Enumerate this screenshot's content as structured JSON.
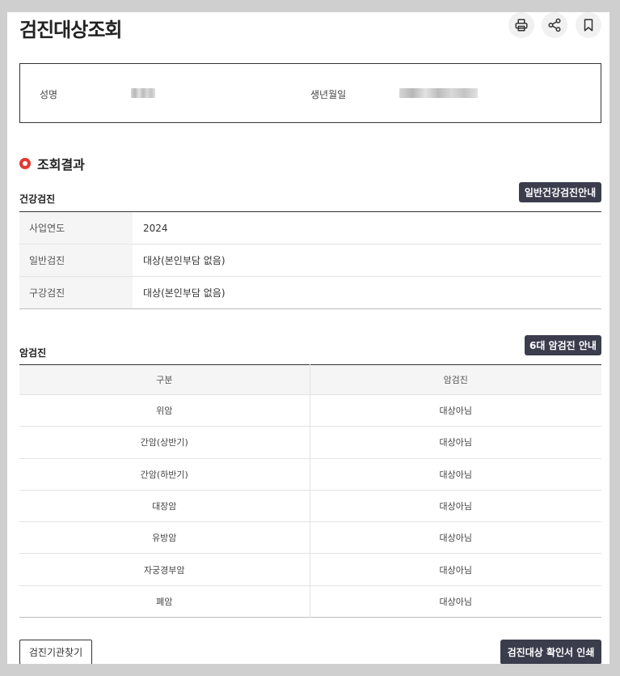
{
  "page": {
    "title": "검진대상조회"
  },
  "toolbar": {
    "print_icon": "print-icon",
    "share_icon": "share-icon",
    "bookmark_icon": "bookmark-icon"
  },
  "person": {
    "name_label": "성명",
    "birth_label": "생년월일"
  },
  "results": {
    "title": "조회결과",
    "health": {
      "title": "건강검진",
      "guide_button": "일반건강검진안내",
      "rows": [
        {
          "label": "사업연도",
          "value": "2024"
        },
        {
          "label": "일반검진",
          "value": "대상(본인부담 없음)"
        },
        {
          "label": "구강검진",
          "value": "대상(본인부담 없음)"
        }
      ]
    },
    "cancer": {
      "title": "암검진",
      "guide_button": "6대 암검진 안내",
      "headers": [
        "구분",
        "암검진"
      ],
      "rows": [
        {
          "type": "위암",
          "status": "대상아님"
        },
        {
          "type": "간암(상반기)",
          "status": "대상아님"
        },
        {
          "type": "간암(하반기)",
          "status": "대상아님"
        },
        {
          "type": "대장암",
          "status": "대상아님"
        },
        {
          "type": "유방암",
          "status": "대상아님"
        },
        {
          "type": "자궁경부암",
          "status": "대상아님"
        },
        {
          "type": "폐암",
          "status": "대상아님"
        }
      ]
    }
  },
  "actions": {
    "find_institution": "검진기관찾기",
    "print_certificate": "검진대상 확인서 인쇄"
  },
  "colors": {
    "accent": "#e23b32",
    "dark_button": "#3b3d4d",
    "row_header_bg": "#f5f5f5"
  }
}
